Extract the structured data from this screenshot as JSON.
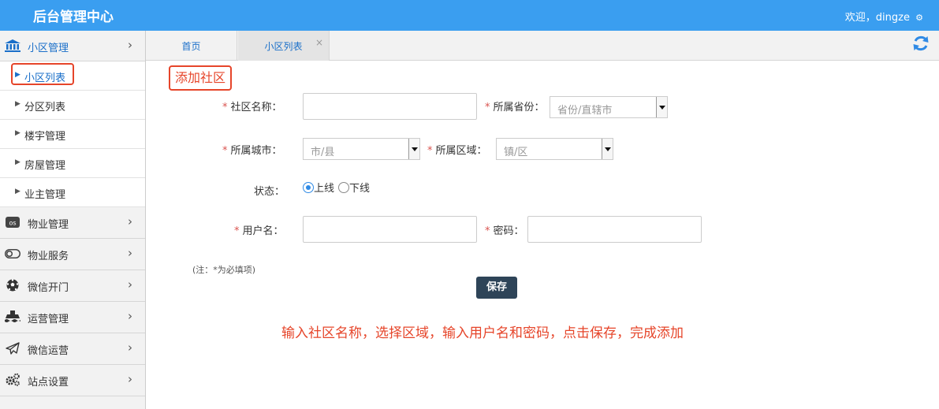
{
  "header": {
    "app_title": "后台管理中心",
    "welcome": "欢迎，dingze"
  },
  "sidebar": {
    "groups": [
      {
        "label": "小区管理",
        "icon": "bank-icon"
      },
      {
        "label": "物业管理",
        "icon": "os-icon"
      },
      {
        "label": "物业服务",
        "icon": "toggle-icon"
      },
      {
        "label": "微信开门",
        "icon": "football-icon"
      },
      {
        "label": "运营管理",
        "icon": "ship-icon"
      },
      {
        "label": "微信运营",
        "icon": "paper-plane-icon"
      },
      {
        "label": "站点设置",
        "icon": "gears-icon"
      }
    ],
    "sub_items": [
      "小区列表",
      "分区列表",
      "楼宇管理",
      "房屋管理",
      "业主管理"
    ]
  },
  "tabs": [
    {
      "label": "首页"
    },
    {
      "label": "小区列表",
      "close": "×"
    }
  ],
  "form": {
    "section_title": "添加社区",
    "community_name_label": "社区名称：",
    "province_label": "所属省份：",
    "province_placeholder": "省份/直辖市",
    "city_label": "所属城市：",
    "city_placeholder": "市/县",
    "district_label": "所属区域：",
    "district_placeholder": "镇/区",
    "status_label": "状态：",
    "status_options": [
      "上线",
      "下线"
    ],
    "status_selected": "上线",
    "username_label": "用户名：",
    "password_label": "密码：",
    "required_mark": "*",
    "note": "(注：*为必填项)",
    "save_label": "保存"
  },
  "annotation": "输入社区名称，选择区域，输入用户名和密码，点击保存，完成添加",
  "colors": {
    "topbar": "#3a9ef0",
    "highlight": "#e6452a",
    "link": "#1a6fc9",
    "save_button": "#2e4458"
  }
}
